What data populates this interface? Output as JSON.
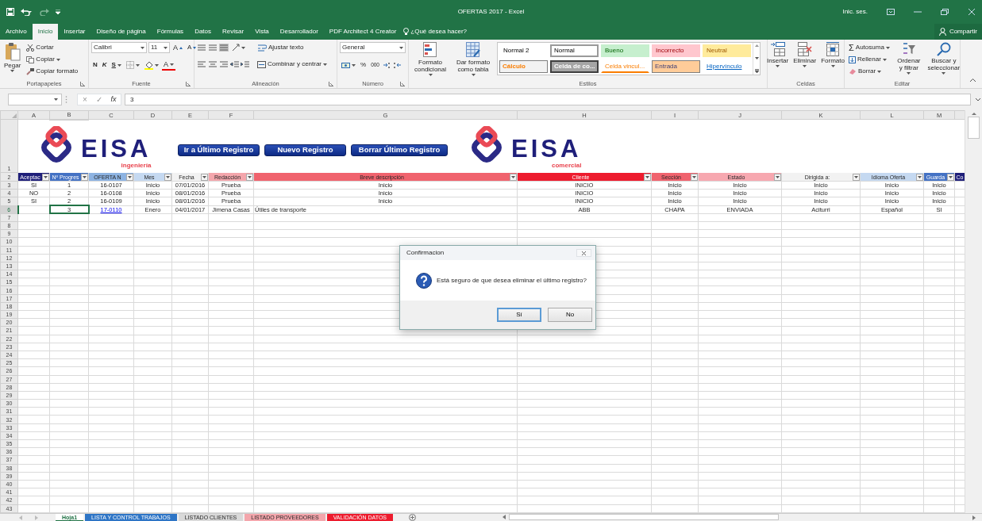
{
  "window": {
    "title": "OFERTAS 2017 - Excel",
    "account": "Inic. ses."
  },
  "ribbon_tabs": [
    {
      "label": "Archivo",
      "selected": false
    },
    {
      "label": "Inicio",
      "selected": true
    },
    {
      "label": "Insertar",
      "selected": false
    },
    {
      "label": "Diseño de página",
      "selected": false
    },
    {
      "label": "Fórmulas",
      "selected": false
    },
    {
      "label": "Datos",
      "selected": false
    },
    {
      "label": "Revisar",
      "selected": false
    },
    {
      "label": "Vista",
      "selected": false
    },
    {
      "label": "Desarrollador",
      "selected": false
    },
    {
      "label": "PDF Architect 4 Creator",
      "selected": false
    }
  ],
  "tell_me": "¿Qué desea hacer?",
  "share": "Compartir",
  "ribbon_groups": [
    {
      "kind": "clipboard",
      "label": "Portapapeles",
      "launcher": true,
      "paste": "Pegar",
      "cut": "Cortar",
      "copy": "Copiar",
      "format_painter": "Copiar formato"
    },
    {
      "kind": "font",
      "label": "Fuente",
      "launcher": true,
      "font_name": "Calibri",
      "font_size": "11",
      "grow": "A",
      "shrink": "A",
      "bold": "N",
      "italic": "K",
      "underline": "S",
      "font_color": "A"
    },
    {
      "kind": "alignment",
      "label": "Alineación",
      "launcher": true,
      "vertical_alignment": [
        {
          "selected": false
        },
        {
          "selected": false
        },
        {
          "selected": true
        }
      ],
      "wrap": "Ajustar texto",
      "merge": "Combinar y centrar"
    },
    {
      "kind": "number",
      "label": "Número",
      "launcher": true,
      "format": "General",
      "percent": "%",
      "thousands": "000"
    },
    {
      "kind": "styles",
      "label": "Estilos",
      "conditional": "Formato condicional",
      "as_table": "Dar formato como tabla",
      "gallery": [
        {
          "label": "Normal 2",
          "kind": "plain",
          "color": "#ffffff",
          "selected": false
        },
        {
          "label": "Normal",
          "kind": "plain",
          "color": "#ffffff",
          "selected": true
        },
        {
          "label": "Bueno",
          "kind": "good",
          "color": "#c6efce",
          "selected": false
        },
        {
          "label": "Incorrecto",
          "kind": "bad",
          "color": "#ffc7ce",
          "selected": false
        },
        {
          "label": "Neutral",
          "kind": "neutral",
          "color": "#ffeb9c",
          "selected": false
        },
        {
          "label": "Cálculo",
          "kind": "calc",
          "color": "#f2f2f2",
          "selected": false
        },
        {
          "label": "Celda de co...",
          "kind": "check",
          "color": "#a5a5a5",
          "selected": false
        },
        {
          "label": "Celda vincul...",
          "kind": "linked",
          "color": "#ffffff",
          "selected": false
        },
        {
          "label": "Entrada",
          "kind": "input",
          "color": "#ffcc99",
          "selected": false
        },
        {
          "label": "Hipervínculo",
          "kind": "link",
          "color": "#ffffff",
          "selected": false
        }
      ]
    },
    {
      "kind": "cells",
      "label": "Celdas",
      "buttons": [
        "Insertar",
        "Eliminar",
        "Formato"
      ]
    },
    {
      "kind": "editing",
      "label": "Editar",
      "autosum_symbol": "Σ",
      "autosum": "Autosuma",
      "fill": "Rellenar",
      "clear": "Borrar",
      "sort": "Ordenar y filtrar",
      "find": "Buscar y seleccionar"
    }
  ],
  "formula_bar": {
    "cancel": "×",
    "enter": "✓",
    "function": "fx",
    "value": "3"
  },
  "sheet": {
    "column_letters": [
      "A",
      "B",
      "C",
      "D",
      "E",
      "F",
      "G",
      "H",
      "I",
      "J",
      "K",
      "L",
      "M"
    ],
    "row_numbers": [
      "1",
      "2",
      "3",
      "4",
      "5",
      "6",
      "7",
      "8",
      "9",
      "10",
      "11",
      "12",
      "13",
      "14",
      "15",
      "16",
      "17",
      "18",
      "19",
      "20",
      "21",
      "22",
      "23",
      "24",
      "25",
      "26",
      "27",
      "28",
      "29",
      "30",
      "31",
      "32",
      "33",
      "34",
      "35",
      "36",
      "37",
      "38",
      "39",
      "40",
      "41",
      "42",
      "43"
    ],
    "shapes": [
      {
        "kind": "logo",
        "text": "EISA",
        "subtitle": "ingeniería"
      },
      {
        "kind": "button",
        "label": "Ir a Último Registro"
      },
      {
        "kind": "button",
        "label": "Nuevo Registro"
      },
      {
        "kind": "button",
        "label": "Borrar Último Registro"
      },
      {
        "kind": "logo",
        "text": "EISA",
        "subtitle": "comercial"
      }
    ],
    "headers": [
      {
        "text": "Aceptac",
        "color": "#1f1f7a",
        "filter": true
      },
      {
        "text": "Nº Progres",
        "color": "#4472c4",
        "filter": true
      },
      {
        "text": "OFERTA N",
        "color": "#8db3e2",
        "filter": true
      },
      {
        "text": "Mes",
        "color": "#c5d9f1",
        "filter": true
      },
      {
        "text": "Fecha",
        "color": "#f2f2f2",
        "filter": true
      },
      {
        "text": "Redacción",
        "color": "#f4a6ac",
        "filter": true
      },
      {
        "text": "Breve descripción",
        "color": "#f0636e",
        "filter": true
      },
      {
        "text": "Cliente",
        "color": "#ed1c2e",
        "filter": true
      },
      {
        "text": "Sección",
        "color": "#f0636e",
        "filter": true
      },
      {
        "text": "Estado",
        "color": "#f7a8b0",
        "filter": true
      },
      {
        "text": "Dirigida a:",
        "color": "#f2f2f2",
        "filter": true
      },
      {
        "text": "Idioma Oferta",
        "color": "#c5d9f1",
        "filter": true
      },
      {
        "text": "Guarda",
        "color": "#4472c4",
        "filter": true
      },
      {
        "text": "Co",
        "color": "#1f1f7a",
        "filter": false
      }
    ],
    "rows": [
      {
        "cells": [
          {
            "text": "SI",
            "selected": false
          },
          {
            "text": "1",
            "selected": false
          },
          {
            "text": "16-0107",
            "selected": false
          },
          {
            "text": "Inicio",
            "selected": false
          },
          {
            "text": "07/01/2016",
            "selected": false
          },
          {
            "text": "Prueba",
            "selected": false
          },
          {
            "text": "Inicio",
            "selected": false
          },
          {
            "text": "INICIO",
            "selected": false
          },
          {
            "text": "Inicio",
            "selected": false
          },
          {
            "text": "Inicio",
            "selected": false
          },
          {
            "text": "Inicio",
            "selected": false
          },
          {
            "text": "Inicio",
            "selected": false
          },
          {
            "text": "Inicio",
            "selected": false
          }
        ]
      },
      {
        "cells": [
          {
            "text": "NO",
            "selected": false
          },
          {
            "text": "2",
            "selected": false
          },
          {
            "text": "16-0108",
            "selected": false
          },
          {
            "text": "Inicio",
            "selected": false
          },
          {
            "text": "08/01/2016",
            "selected": false
          },
          {
            "text": "Prueba",
            "selected": false
          },
          {
            "text": "Inicio",
            "selected": false
          },
          {
            "text": "INICIO",
            "selected": false
          },
          {
            "text": "Inicio",
            "selected": false
          },
          {
            "text": "Inicio",
            "selected": false
          },
          {
            "text": "Inicio",
            "selected": false
          },
          {
            "text": "Inicio",
            "selected": false
          },
          {
            "text": "Inicio",
            "selected": false
          }
        ]
      },
      {
        "cells": [
          {
            "text": "SI",
            "selected": false
          },
          {
            "text": "2",
            "selected": false
          },
          {
            "text": "16-0109",
            "selected": false
          },
          {
            "text": "Inicio",
            "selected": false
          },
          {
            "text": "08/01/2016",
            "selected": false
          },
          {
            "text": "Prueba",
            "selected": false
          },
          {
            "text": "Inicio",
            "selected": false
          },
          {
            "text": "INICIO",
            "selected": false
          },
          {
            "text": "Inicio",
            "selected": false
          },
          {
            "text": "Inicio",
            "selected": false
          },
          {
            "text": "Inicio",
            "selected": false
          },
          {
            "text": "Inicio",
            "selected": false
          },
          {
            "text": "Inicio",
            "selected": false
          }
        ]
      },
      {
        "cells": [
          {
            "selected": false
          },
          {
            "text": "3",
            "selected": true
          },
          {
            "text": "17-0110",
            "kind": "link",
            "selected": false
          },
          {
            "text": "Enero",
            "selected": false
          },
          {
            "text": "04/01/2017",
            "selected": false
          },
          {
            "text": "Jimena Casas",
            "selected": false
          },
          {
            "text": "Útiles de transporte",
            "kind": "text",
            "selected": false
          },
          {
            "text": "ABB",
            "selected": false
          },
          {
            "text": "CHAPA",
            "selected": false
          },
          {
            "text": "ENVIADA",
            "selected": false
          },
          {
            "text": "Aciturri",
            "selected": false
          },
          {
            "text": "Español",
            "selected": false
          },
          {
            "text": "SI",
            "selected": false
          }
        ]
      }
    ]
  },
  "dialog": {
    "title": "Confirmacion",
    "message": "Está seguro de que desea eliminar el último registro?",
    "buttons": [
      {
        "label": "Sí",
        "default": true
      },
      {
        "label": "No",
        "default": false
      }
    ]
  },
  "sheet_tabs": [
    {
      "label": "Hoja1",
      "selected": true,
      "color": "#ffffff"
    },
    {
      "label": "LISTA Y CONTROL TRABAJOS",
      "selected": false,
      "color": "#2e75c6"
    },
    {
      "label": "LISTADO CLIENTES",
      "selected": false,
      "color": "#d9d9d9"
    },
    {
      "label": "LISTADO PROVEEDORES",
      "selected": false,
      "color": "#f4a6ac"
    },
    {
      "label": "VALIDACIÓN DATOS",
      "selected": false,
      "color": "#ed1c2e"
    }
  ]
}
